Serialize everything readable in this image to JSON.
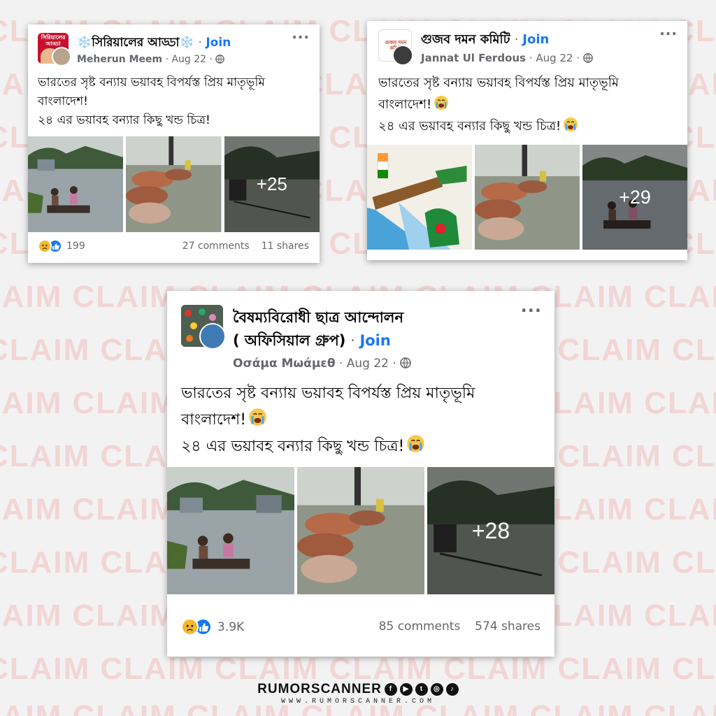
{
  "watermark": {
    "word": "CLAIM"
  },
  "posts": [
    {
      "group_name": "❄️সিরিয়ালের আড্ডা❄️",
      "join": "Join",
      "author": "Meherun Meem",
      "date": "Aug 22",
      "avatar_text": "সিরিয়ালের আড্ডা",
      "text_line1": "ভারতের সৃষ্ট বন্যায় ভয়াবহ বিপর্যস্ত প্রিয় মাতৃভূমি",
      "text_line2": "বাংলাদেশ!",
      "text_line3": "২৪ এর ভয়াবহ বন্যার কিছু খন্ড চিত্র!",
      "more_photos": "+25",
      "reactions_count": "199",
      "comments": "27 comments",
      "shares": "11 shares"
    },
    {
      "group_name": "গুজব দমন কমিটি",
      "join": "Join",
      "author": "Jannat Ul Ferdous",
      "date": "Aug 22",
      "avatar_text": "গুজব দমন কমিটি",
      "text_line1": "ভারতের সৃষ্ট বন্যায় ভয়াবহ বিপর্যস্ত প্রিয় মাতৃভূমি",
      "text_line2": "বাংলাদেশ!",
      "text_line3": "২৪ এর ভয়াবহ বন্যার কিছু খন্ড চিত্র!",
      "more_photos": "+29"
    },
    {
      "group_name_line1": "বৈষম্যবিরোধী ছাত্র আন্দোলন",
      "group_name_line2": "( অফিসিয়াল গ্রুপ)",
      "join": "Join",
      "author": "Οσάμα Μωάμεθ",
      "date": "Aug 22",
      "text_line1": "ভারতের সৃষ্ট বন্যায় ভয়াবহ বিপর্যস্ত প্রিয় মাতৃভূমি",
      "text_line2": "বাংলাদেশ!",
      "text_line3": "২৪ এর ভয়াবহ বন্যার কিছু খন্ড চিত্র!",
      "more_photos": "+28",
      "reactions_count": "3.9K",
      "comments": "85 comments",
      "shares": "574 shares"
    }
  ],
  "footer": {
    "brand": "RUMORSCANNER",
    "site": "WWW.RUMORSCANNER.COM",
    "social_icons": [
      "facebook-icon",
      "youtube-icon",
      "twitter-icon",
      "instagram-icon",
      "tiktok-icon"
    ]
  },
  "colors": {
    "accent": "#1877f2",
    "watermark": "#f2d5d5",
    "background": "#f3f2f2"
  }
}
